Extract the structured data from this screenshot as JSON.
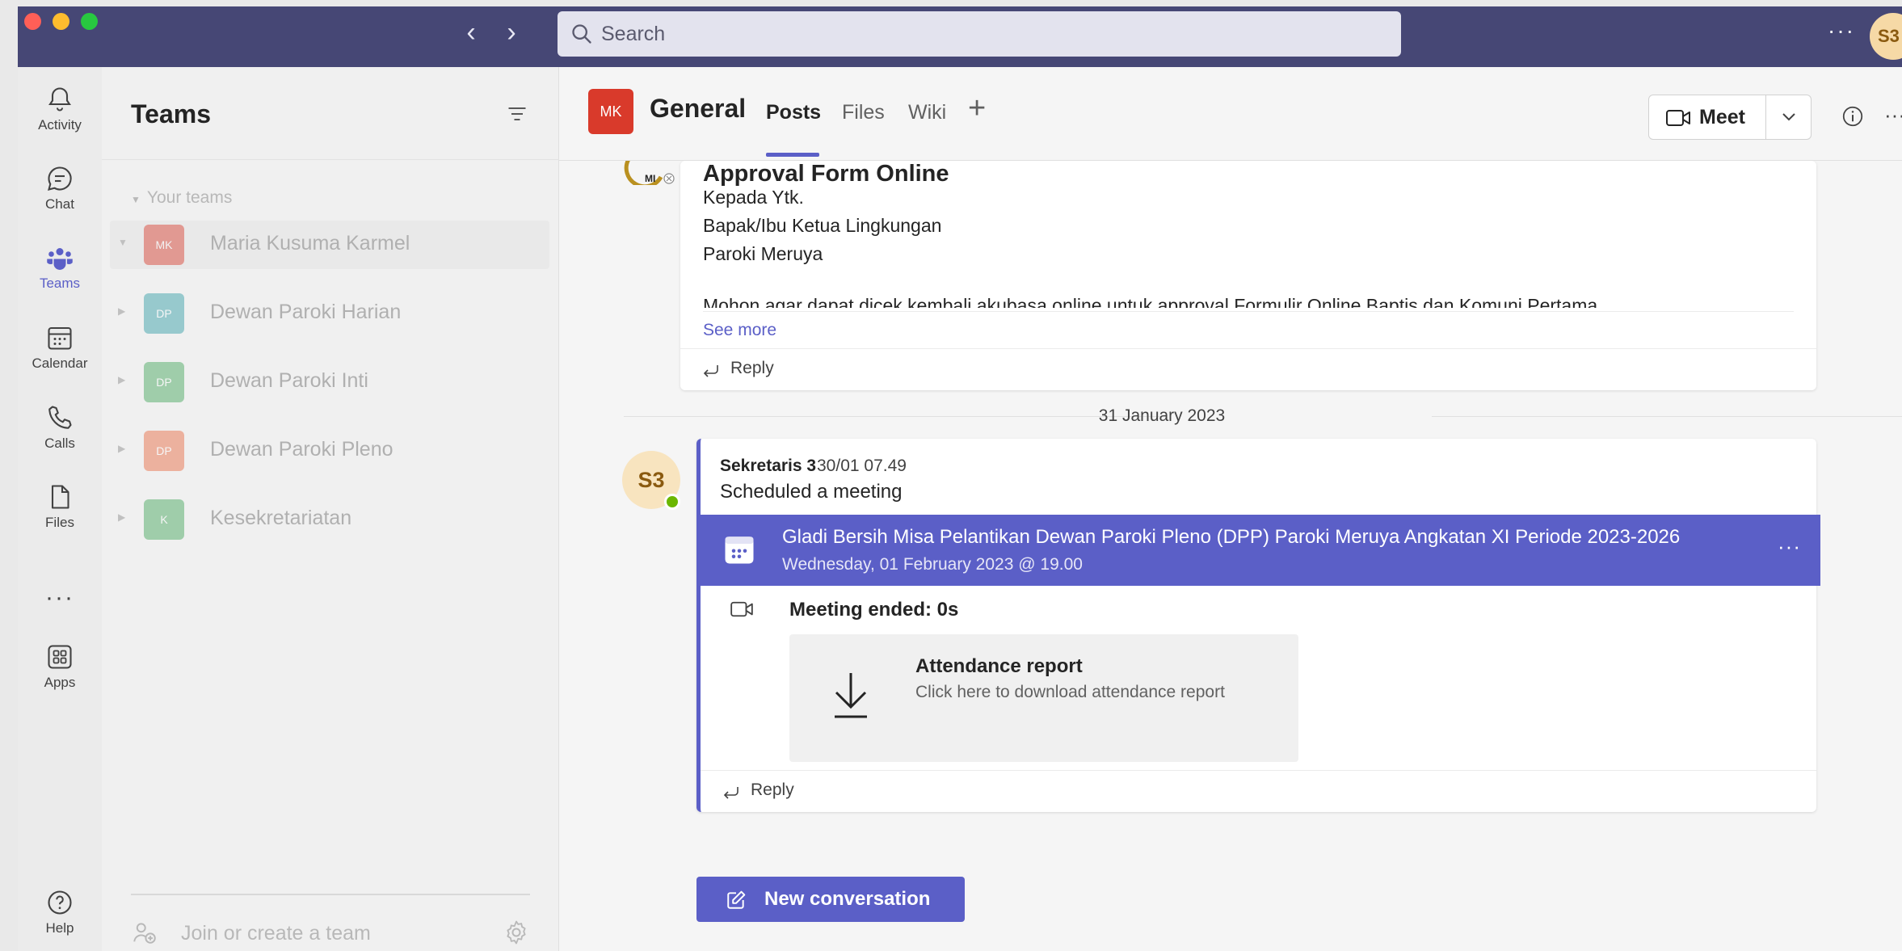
{
  "search": {
    "placeholder": "Search"
  },
  "user": {
    "initials": "S3"
  },
  "rail": {
    "items": [
      {
        "label": "Activity",
        "icon": "bell-icon"
      },
      {
        "label": "Chat",
        "icon": "chat-icon"
      },
      {
        "label": "Teams",
        "icon": "teams-icon"
      },
      {
        "label": "Calendar",
        "icon": "calendar-icon"
      },
      {
        "label": "Calls",
        "icon": "phone-icon"
      },
      {
        "label": "Files",
        "icon": "file-icon"
      },
      {
        "label": "Apps",
        "icon": "apps-icon"
      },
      {
        "label": "Help",
        "icon": "help-icon"
      }
    ],
    "more": "···"
  },
  "teams_panel": {
    "title": "Teams",
    "section_label": "Your teams",
    "teams": [
      {
        "initials": "MK",
        "name": "Maria Kusuma Karmel",
        "color": "#d93a2b"
      },
      {
        "initials": "DP",
        "name": "Dewan Paroki Harian",
        "color": "#2d9aa4"
      },
      {
        "initials": "DP",
        "name": "Dewan Paroki Inti",
        "color": "#3fa356"
      },
      {
        "initials": "DP",
        "name": "Dewan Paroki Pleno",
        "color": "#e8663c"
      },
      {
        "initials": "K",
        "name": "Kesekretariatan",
        "color": "#3fa356"
      }
    ],
    "join_label": "Join or create a team"
  },
  "channel": {
    "avatar": "MK",
    "name": "General",
    "tabs": {
      "posts": "Posts",
      "files": "Files",
      "wiki": "Wiki"
    },
    "meet_label": "Meet"
  },
  "post1": {
    "subject": "Approval Form Online",
    "lines": [
      "Kepada Ytk.",
      "Bapak/Ibu Ketua Lingkungan",
      "Paroki Meruya"
    ],
    "truncated": "Mohon agar dapat dicek kembali akubasa online untuk approval Formulir Online Baptis dan Komuni Pertama",
    "see_more": "See more",
    "reply": "Reply"
  },
  "date_divider": "31 January 2023",
  "post2": {
    "avatar": "S3",
    "author": "Sekretaris 3",
    "time": "30/01 07.49",
    "action": "Scheduled a meeting",
    "meeting_title": "Gladi Bersih Misa Pelantikan Dewan Paroki Pleno (DPP) Paroki Meruya Angkatan XI Periode 2023-2026",
    "meeting_date": "Wednesday, 01 February 2023 @ 19.00",
    "ended": "Meeting ended: 0s",
    "attendance_title": "Attendance report",
    "attendance_sub": "Click here to download attendance report",
    "reply": "Reply"
  },
  "new_conversation": "New conversation",
  "colors": {
    "titlebar": "#464775",
    "accent": "#5b5fc7",
    "presence": "#6bb700"
  }
}
